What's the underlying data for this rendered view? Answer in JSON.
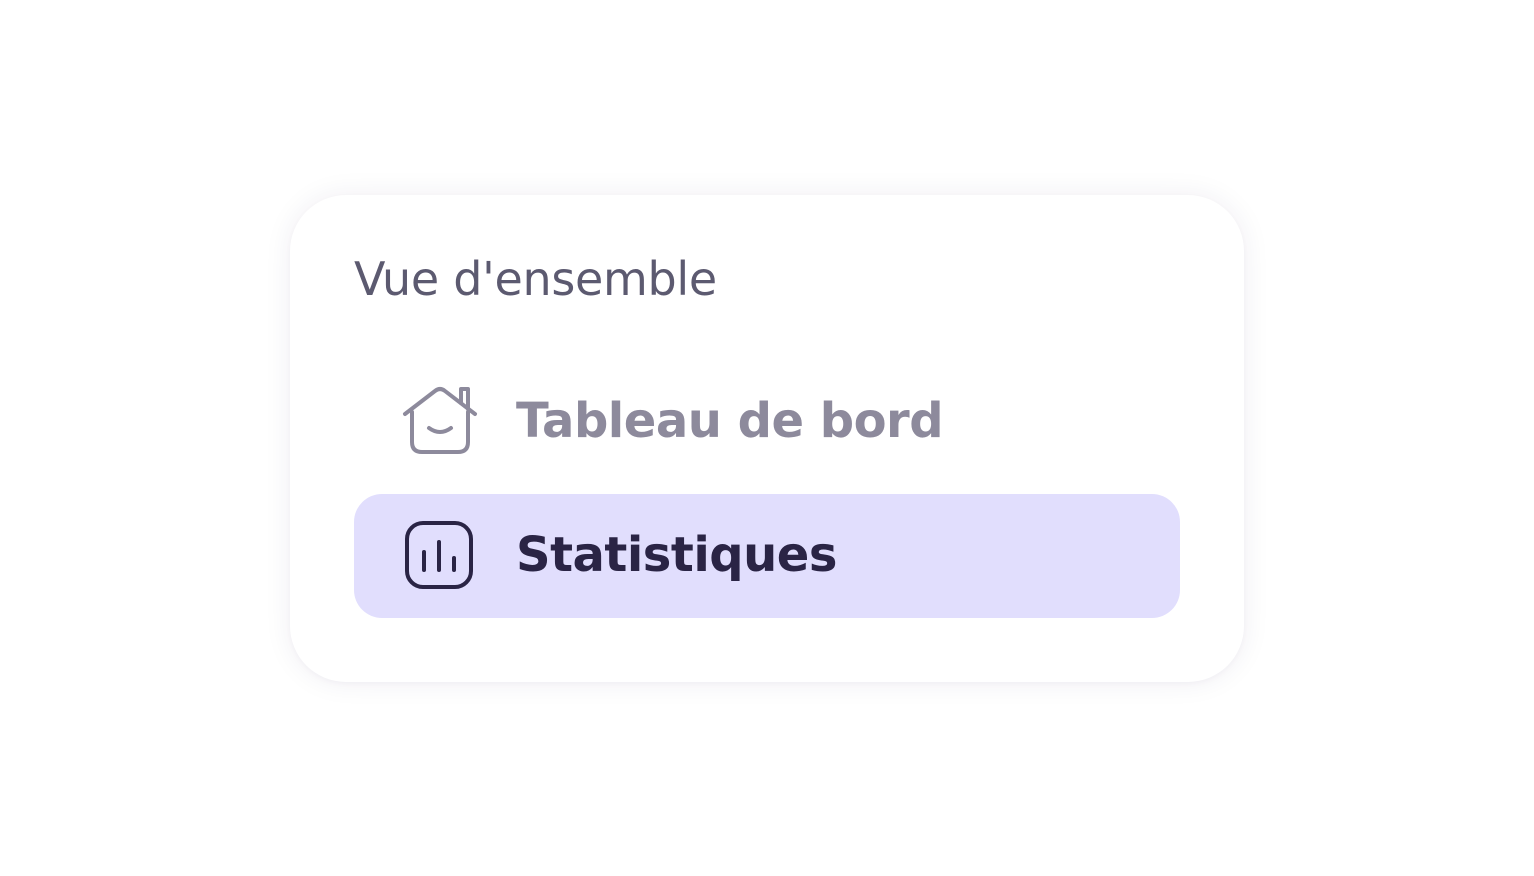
{
  "nav": {
    "section_title": "Vue d'ensemble",
    "items": [
      {
        "label": "Tableau de bord",
        "icon": "house-smile-icon",
        "active": false
      },
      {
        "label": "Statistiques",
        "icon": "bar-chart-square-icon",
        "active": true
      }
    ]
  },
  "colors": {
    "active_background": "#e1defd",
    "active_text": "#2a2445",
    "inactive_text": "#8d8a9c",
    "section_title": "#5c5a70"
  }
}
